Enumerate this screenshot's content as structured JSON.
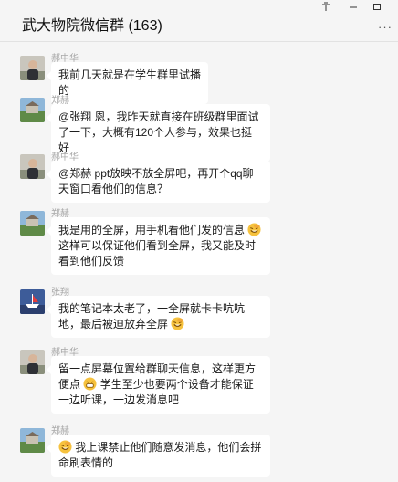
{
  "window": {
    "title": "武大物院微信群 (163)",
    "controls": {
      "pin": "⽊",
      "minimize": "—",
      "maximize": "□",
      "more": "···"
    }
  },
  "messages": [
    {
      "sender": "郝中华",
      "avatar": "person-photo",
      "text": "我前几天就是在学生群里试播的"
    },
    {
      "sender": "郑赫",
      "avatar": "campus-photo",
      "text": "@张翔 恩，我昨天就直接在班级群里面试了一下，大概有120个人参与，效果也挺好"
    },
    {
      "sender": "郝中华",
      "avatar": "person-photo",
      "text": "@郑赫 ppt放映不放全屏吧，再开个qq聊天窗口看他们的信息？"
    },
    {
      "sender": "郑赫",
      "avatar": "campus-photo",
      "text_a": "我是用的全屏，用手机看他们发的信息",
      "emoji": "facepalm-laugh-emoji",
      "text_b": "这样可以保证他们看到全屏，我又能及时看到他们反馈"
    },
    {
      "sender": "张翔",
      "avatar": "boat-photo",
      "text": "我的笔记本太老了，一全屏就卡卡吭吭地，最后被迫放弃全屏",
      "emoji": "facepalm-laugh-emoji"
    },
    {
      "sender": "郝中华",
      "avatar": "person-photo",
      "text_a": "留一点屏幕位置给群聊天信息，这样更方便点",
      "emoji": "grin-emoji",
      "text_b": "学生至少也要两个设备才能保证一边听课，一边发消息吧"
    },
    {
      "sender": "郑赫",
      "avatar": "campus-photo",
      "emoji": "facepalm-laugh-emoji",
      "text": "我上课禁止他们随意发消息，他们会拼命刷表情的"
    }
  ],
  "colors": {
    "background": "#f5f5f5",
    "bubble": "#ffffff",
    "sender_text": "#a8a8a8"
  }
}
